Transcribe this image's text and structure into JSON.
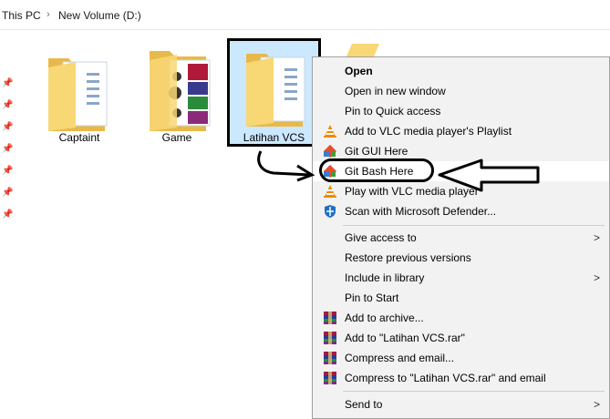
{
  "address": {
    "crumb1": "This PC",
    "crumb2": "New Volume (D:)",
    "separator": ">"
  },
  "folders": [
    {
      "label": "Captaint"
    },
    {
      "label": "Game"
    },
    {
      "label": "Latihan VCS"
    }
  ],
  "menu": {
    "items": [
      {
        "label": "Open",
        "bold": true,
        "icon": ""
      },
      {
        "label": "Open in new window",
        "icon": ""
      },
      {
        "label": "Pin to Quick access",
        "icon": ""
      },
      {
        "label": "Add to VLC media player's Playlist",
        "icon": "vlc-icon"
      },
      {
        "label": "Git GUI Here",
        "icon": "git-icon"
      },
      {
        "label": "Git Bash Here",
        "icon": "git-icon",
        "highlighted": true
      },
      {
        "label": "Play with VLC media player",
        "icon": "vlc-icon"
      },
      {
        "label": "Scan with Microsoft Defender...",
        "icon": "defender-icon"
      },
      {
        "label": "Give access to",
        "icon": "",
        "submenu": true
      },
      {
        "label": "Restore previous versions",
        "icon": ""
      },
      {
        "label": "Include in library",
        "icon": "",
        "submenu": true
      },
      {
        "label": "Pin to Start",
        "icon": ""
      },
      {
        "label": "Add to archive...",
        "icon": "winrar-icon"
      },
      {
        "label": "Add to \"Latihan VCS.rar\"",
        "icon": "winrar-icon"
      },
      {
        "label": "Compress and email...",
        "icon": "winrar-icon"
      },
      {
        "label": "Compress to \"Latihan VCS.rar\" and email",
        "icon": "winrar-icon"
      },
      {
        "label": "Send to",
        "icon": "",
        "submenu": true
      }
    ],
    "submenu_arrow": ">"
  },
  "colors": {
    "selection": "#cce8ff",
    "menu_bg": "#f2f2f2",
    "folder": "#f8d775"
  }
}
